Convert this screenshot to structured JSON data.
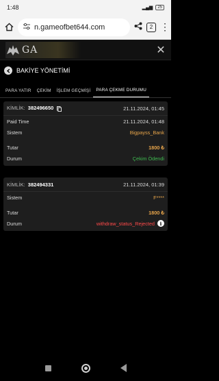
{
  "status_bar": {
    "time": "1:48",
    "battery": "25"
  },
  "browser": {
    "url": "n.gameofbet644.com",
    "tab_count": "2"
  },
  "site": {
    "logo_text": "GA"
  },
  "page": {
    "title": "BAKİYE YÖNETİMİ"
  },
  "tabs": [
    {
      "label": "PARA YATIR"
    },
    {
      "label": "ÇEKİM"
    },
    {
      "label": "İŞLEM GEÇMİŞİ"
    },
    {
      "label": "PARA ÇEKME DURUMU"
    }
  ],
  "active_tab": "PARA ÇEKME DURUMU",
  "withdrawals": [
    {
      "id_label": "KİMLİK:",
      "id": "382496650",
      "date": "21.11.2024, 01:45",
      "paid_time_label": "Paid Time",
      "paid_time": "21.11.2024, 01:48",
      "system_label": "Sistem",
      "system": "Bigpayss_Bank",
      "amount_label": "Tutar",
      "amount": "1800 ₺",
      "status_label": "Durum",
      "status": "Çekim Ödendi"
    },
    {
      "id_label": "KİMLİK:",
      "id": "382494331",
      "date": "21.11.2024, 01:39",
      "system_label": "Sistem",
      "system": "F****",
      "amount_label": "Tutar",
      "amount": "1800 ₺",
      "status_label": "Durum",
      "status": "withdraw_status_Rejected"
    }
  ],
  "colors": {
    "accent_orange": "#e8a54a",
    "status_paid": "#3fb950",
    "status_rejected": "#ff4a4a"
  }
}
